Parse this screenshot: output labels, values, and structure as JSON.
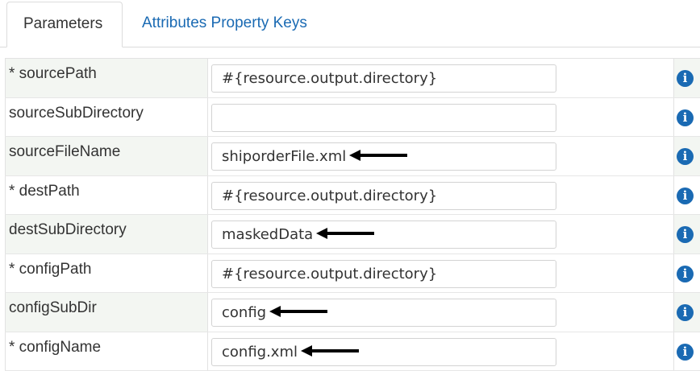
{
  "tabs": [
    {
      "label": "Parameters",
      "active": true
    },
    {
      "label": "Attributes Property Keys",
      "active": false
    }
  ],
  "icons": {
    "info": "info-icon",
    "arrow": "left-arrow-icon"
  },
  "colors": {
    "accent": "#1a6ab3",
    "row_alt": "#f3f6f2"
  },
  "params": [
    {
      "label": "* sourcePath",
      "value": "#{resource.output.directory}",
      "arrow": false
    },
    {
      "label": "sourceSubDirectory",
      "value": "",
      "arrow": false
    },
    {
      "label": "sourceFileName",
      "value": "shiporderFile.xml",
      "arrow": true
    },
    {
      "label": "* destPath",
      "value": "#{resource.output.directory}",
      "arrow": false
    },
    {
      "label": "destSubDirectory",
      "value": "maskedData",
      "arrow": true
    },
    {
      "label": "* configPath",
      "value": "#{resource.output.directory}",
      "arrow": false
    },
    {
      "label": "configSubDir",
      "value": "config",
      "arrow": true
    },
    {
      "label": "* configName",
      "value": "config.xml",
      "arrow": true
    }
  ]
}
